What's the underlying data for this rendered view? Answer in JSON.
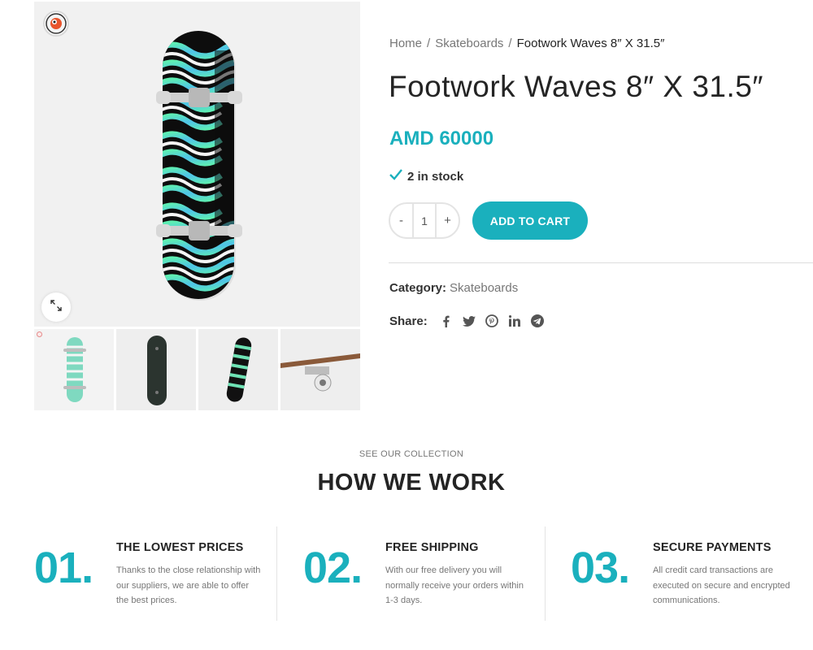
{
  "gallery": {
    "main_image": "Footwork Waves skateboard deck",
    "zoom_icon": "expand-icon",
    "thumbnails": [
      "skateboard-front",
      "skateboard-bottom",
      "skateboard-angled",
      "skateboard-wheel-closeup"
    ]
  },
  "breadcrumb": {
    "home": "Home",
    "category": "Skateboards",
    "current": "Footwork Waves 8″ X 31.5″",
    "separator": "/"
  },
  "product": {
    "title": "Footwork Waves 8″ X 31.5″",
    "price": "AMD 60000",
    "stock": "2 in stock",
    "quantity": "1",
    "minus_label": "-",
    "plus_label": "+",
    "add_to_cart": "ADD TO CART",
    "category_label": "Category:",
    "category_value": "Skateboards",
    "share_label": "Share:",
    "share_icons": [
      "facebook-icon",
      "twitter-icon",
      "pinterest-icon",
      "linkedin-icon",
      "telegram-icon"
    ]
  },
  "how_we_work": {
    "eyebrow": "SEE OUR COLLECTION",
    "title": "HOW WE WORK",
    "features": [
      {
        "num": "01.",
        "title": "THE LOWEST PRICES",
        "text": "Thanks to the close relationship with our suppliers, we are able to offer the best prices."
      },
      {
        "num": "02.",
        "title": "FREE SHIPPING",
        "text": "With our free delivery you will normally receive your orders within 1-3 days."
      },
      {
        "num": "03.",
        "title": "SECURE PAYMENTS",
        "text": "All credit card transactions are executed on secure and encrypted communications."
      }
    ]
  },
  "colors": {
    "accent": "#1ab0bd",
    "text": "#242424",
    "muted": "#777777"
  }
}
